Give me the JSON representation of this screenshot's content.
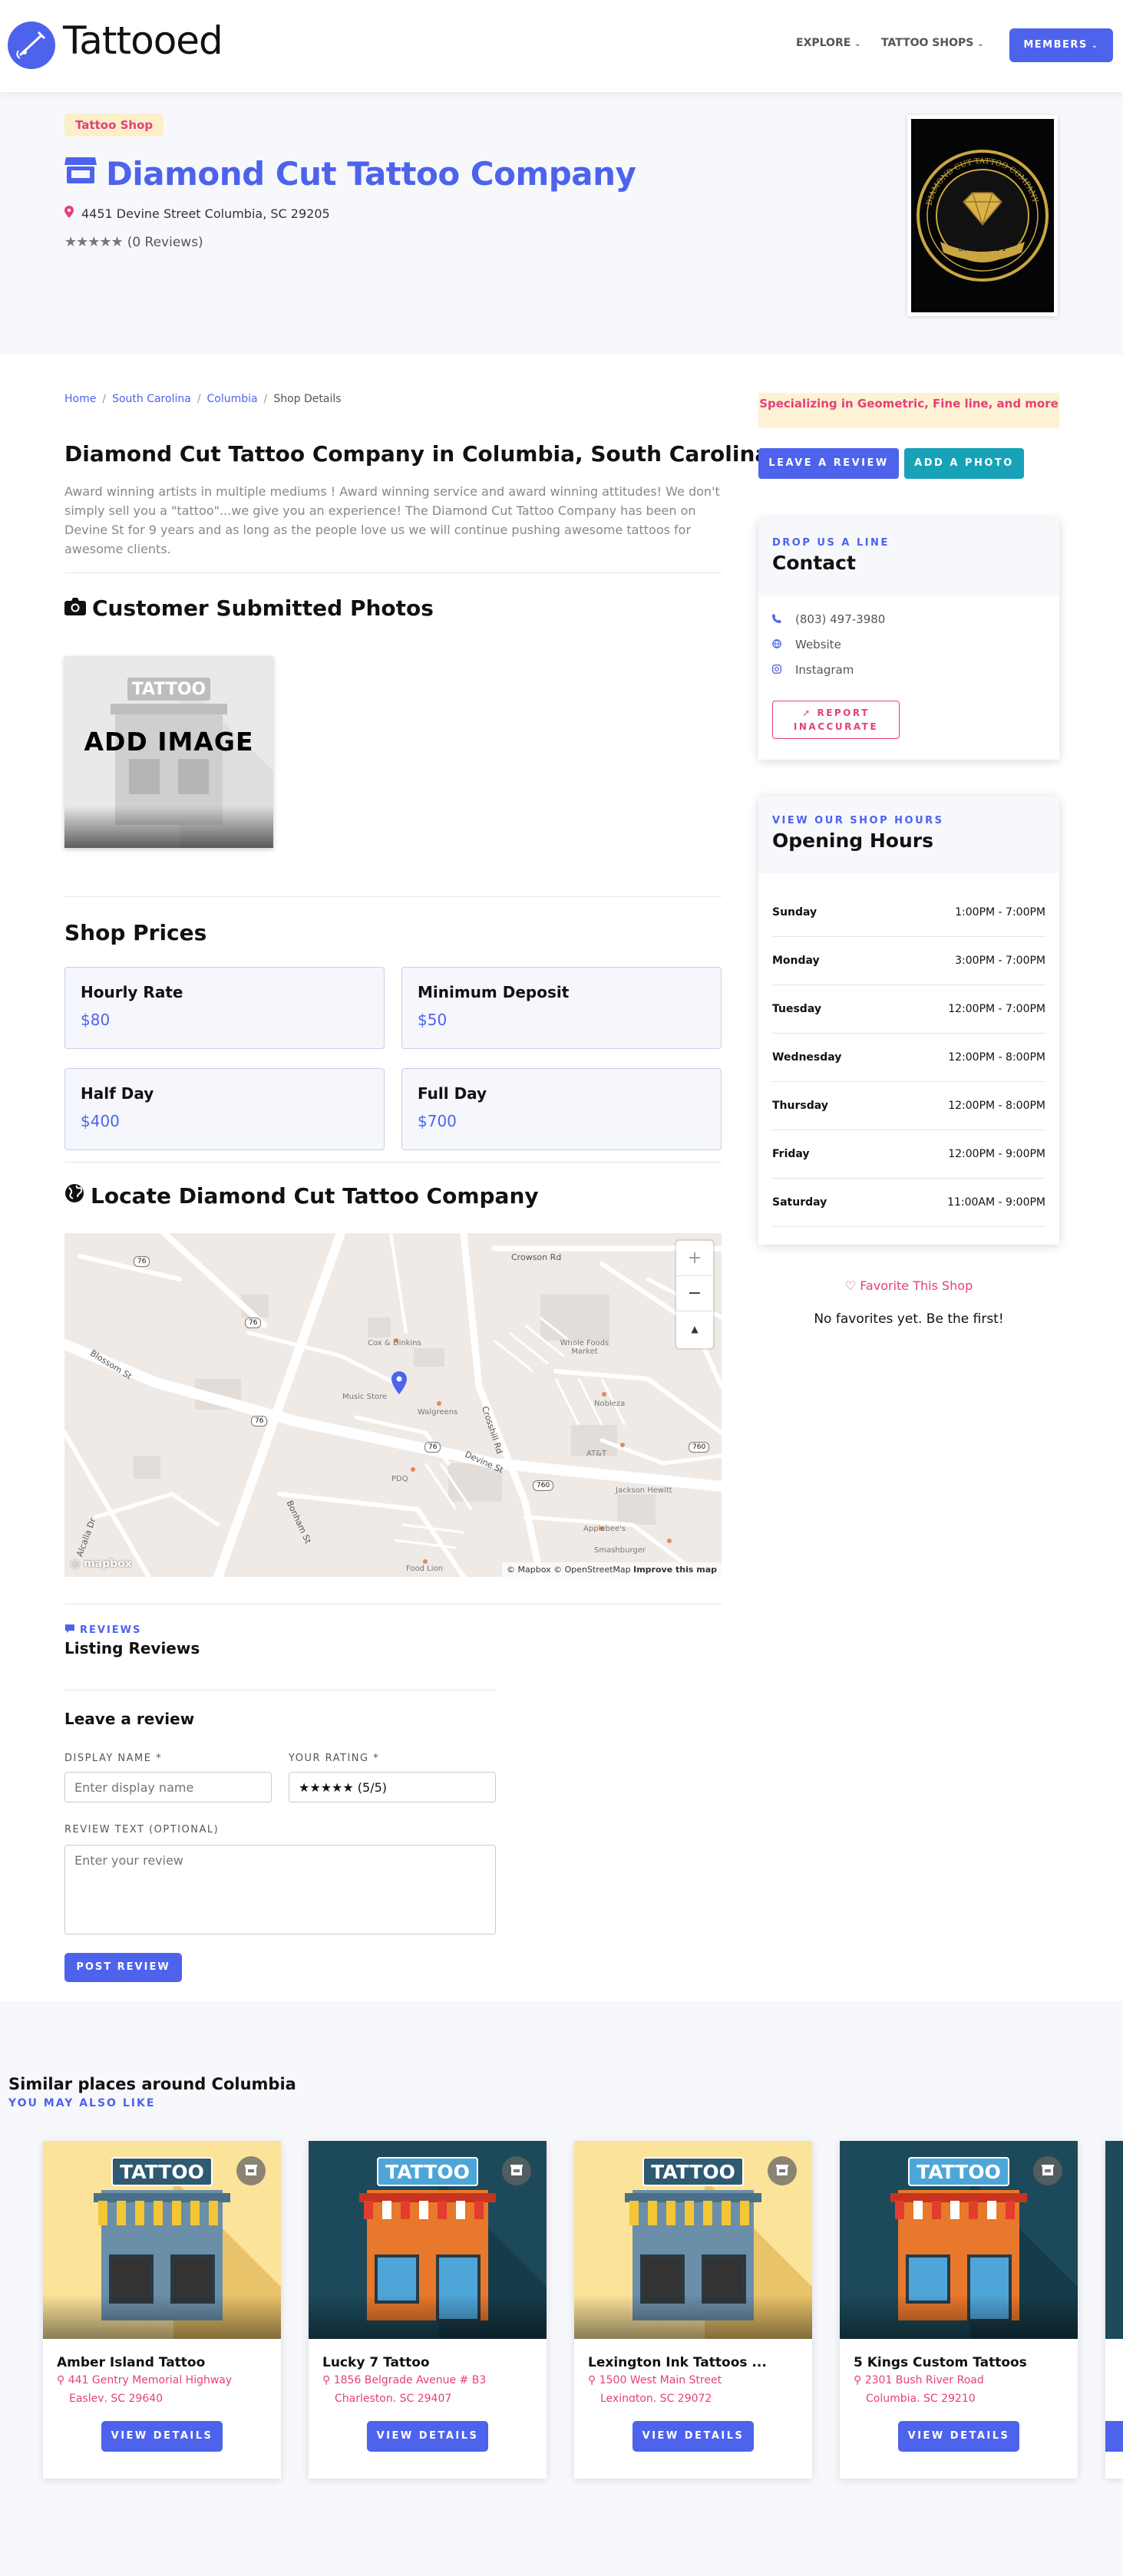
{
  "header": {
    "logo_text": "Tattooed",
    "nav": [
      {
        "label": "EXPLORE"
      },
      {
        "label": "TATTOO SHOPS"
      }
    ],
    "members_label": "MEMBERS"
  },
  "hero": {
    "tag": "Tattoo Shop",
    "title": "Diamond Cut Tattoo Company",
    "address": "4451 Devine Street Columbia, SC 29205",
    "stars": "★★★★★",
    "reviews_count": "(0 Reviews)",
    "logo_caption": "DIAMOND CUT TATTOO COMPANY",
    "logo_since": "Since 2014"
  },
  "breadcrumb": {
    "items": [
      "Home",
      "South Carolina",
      "Columbia"
    ],
    "current": "Shop Details"
  },
  "about": {
    "heading": "Diamond Cut Tattoo Company in Columbia, South Carolina",
    "description": "Award winning artists in multiple mediums ! Award winning service and award winning attitudes! We don't simply sell you a \"tattoo\"...we give you an experience! The Diamond Cut Tattoo Company has been on Devine St for 9 years and as long as the people love us we will continue pushing awesome tattoos for awesome clients."
  },
  "photos": {
    "heading": "Customer Submitted Photos",
    "add_image_sign": "TATTOO",
    "add_image_label": "ADD IMAGE"
  },
  "prices": {
    "heading": "Shop Prices",
    "items": [
      {
        "label": "Hourly Rate",
        "value": "$80"
      },
      {
        "label": "Minimum Deposit",
        "value": "$50"
      },
      {
        "label": "Half Day",
        "value": "$400"
      },
      {
        "label": "Full Day",
        "value": "$700"
      }
    ]
  },
  "map": {
    "heading": "Locate Diamond Cut Tattoo Company",
    "zoom_in": "+",
    "zoom_out": "−",
    "compass": "▲",
    "attribution": "© Mapbox © OpenStreetMap",
    "improve": "Improve this map",
    "brand": "mapbox",
    "road_labels": [
      "Crowson Rd",
      "Blossom St",
      "Devine St",
      "Crosshill Rd",
      "Bonham St",
      "Alcalla Dr"
    ],
    "shields": [
      "76",
      "76",
      "76",
      "76",
      "760",
      "760"
    ],
    "pois": [
      "Cox & Dinkins",
      "Whole Foods Market",
      "Music Store",
      "Walgreens",
      "Nobleza",
      "AT&T",
      "PDQ",
      "Jackson Hewitt",
      "Applebee's",
      "Smashburger",
      "Food Lion"
    ]
  },
  "reviews": {
    "section_label": "REVIEWS",
    "title": "Listing Reviews",
    "leave_heading": "Leave a review",
    "display_name_label": "DISPLAY NAME *",
    "display_name_placeholder": "Enter display name",
    "rating_label": "YOUR RATING *",
    "rating_value": "★★★★★ (5/5)",
    "text_label": "REVIEW TEXT (OPTIONAL)",
    "text_placeholder": "Enter your review",
    "post_label": "POST REVIEW"
  },
  "sidebar": {
    "specializing": "Specializing in Geometric, Fine line, and more",
    "leave_review": "LEAVE A REVIEW",
    "add_photo": "ADD A PHOTO",
    "contact": {
      "small": "DROP US A LINE",
      "title": "Contact",
      "phone": "(803) 497-3980",
      "website": "Website",
      "instagram": "Instagram",
      "report": "REPORT INACCURATE"
    },
    "hours": {
      "small": "VIEW OUR SHOP HOURS",
      "title": "Opening Hours",
      "rows": [
        {
          "day": "Sunday",
          "time": "1:00PM - 7:00PM"
        },
        {
          "day": "Monday",
          "time": "3:00PM - 7:00PM"
        },
        {
          "day": "Tuesday",
          "time": "12:00PM - 7:00PM"
        },
        {
          "day": "Wednesday",
          "time": "12:00PM - 8:00PM"
        },
        {
          "day": "Thursday",
          "time": "12:00PM - 8:00PM"
        },
        {
          "day": "Friday",
          "time": "12:00PM - 9:00PM"
        },
        {
          "day": "Saturday",
          "time": "11:00AM - 9:00PM"
        }
      ]
    },
    "favorite": "Favorite This Shop",
    "no_favorites": "No favorites yet. Be the first!"
  },
  "similar": {
    "title": "Similar places around Columbia",
    "subtitle": "YOU MAY ALSO LIKE",
    "sign": "TATTOO",
    "view_label": "VIEW DETAILS",
    "items": [
      {
        "name": "Amber Island Tattoo",
        "addr1": "441 Gentry Memorial Highway",
        "addr2": "Easley, SC 29640",
        "style": "yellow"
      },
      {
        "name": "Lucky 7 Tattoo",
        "addr1": "1856 Belgrade Avenue # B3",
        "addr2": "Charleston, SC 29407",
        "style": "dark"
      },
      {
        "name": "Lexington Ink Tattoos ...",
        "addr1": "1500 West Main Street",
        "addr2": "Lexington, SC 29072",
        "style": "yellow"
      },
      {
        "name": "5 Kings Custom Tattoos",
        "addr1": "2301 Bush River Road",
        "addr2": "Columbia, SC 29210",
        "style": "dark"
      }
    ]
  },
  "colors": {
    "brand": "#4d63ec",
    "accent": "#e5407b",
    "hero_bg": "#f7f8fc"
  }
}
